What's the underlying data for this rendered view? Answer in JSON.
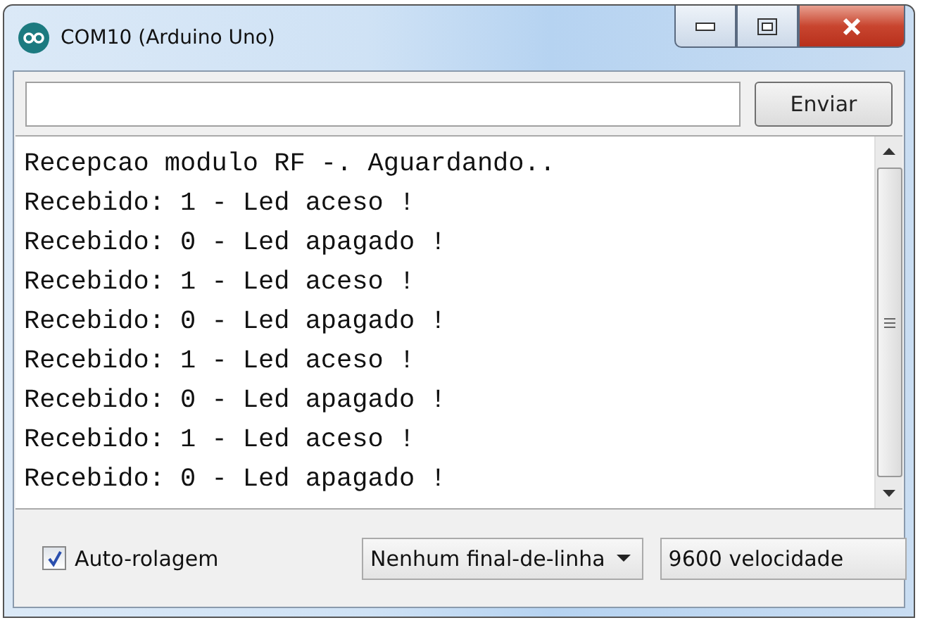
{
  "window": {
    "title": "COM10 (Arduino Uno)"
  },
  "send_bar": {
    "button": "Enviar"
  },
  "output_lines": [
    "Recepcao modulo RF -. Aguardando..",
    "Recebido: 1 - Led aceso !",
    "Recebido: 0 - Led apagado !",
    "Recebido: 1 - Led aceso !",
    "Recebido: 0 - Led apagado !",
    "Recebido: 1 - Led aceso !",
    "Recebido: 0 - Led apagado !",
    "Recebido: 1 - Led aceso !",
    "Recebido: 0 - Led apagado !"
  ],
  "footer": {
    "autoscroll": {
      "label": "Auto-rolagem",
      "checked": true
    },
    "line_ending": "Nenhum final-de-linha",
    "baud_rate": "9600 velocidade"
  }
}
